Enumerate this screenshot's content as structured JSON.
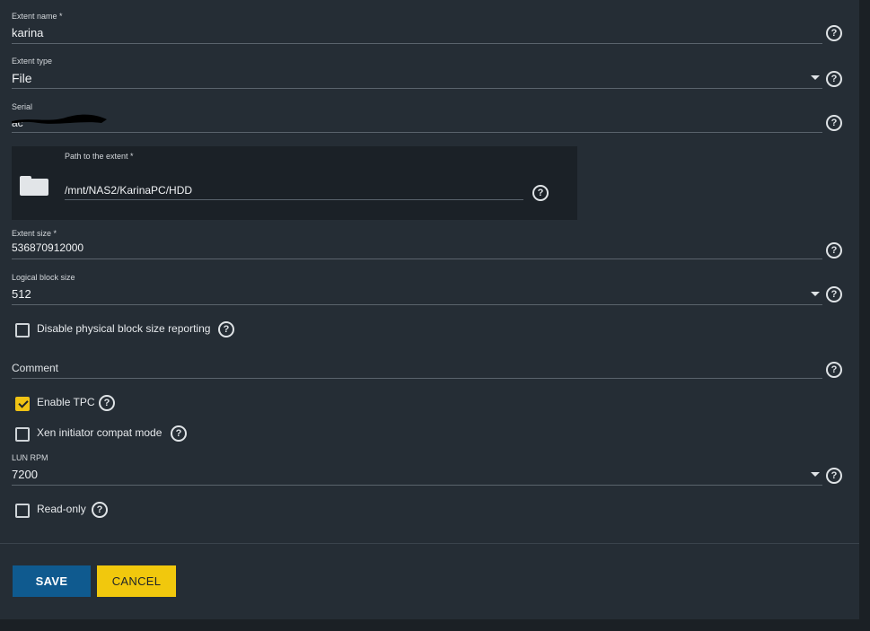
{
  "form": {
    "extent_name": {
      "label": "Extent name *",
      "value": "karina"
    },
    "extent_type": {
      "label": "Extent type",
      "value": "File"
    },
    "serial": {
      "label": "Serial",
      "value": "ac"
    },
    "path": {
      "label": "Path to the extent *",
      "value": "/mnt/NAS2/KarinaPC/HDD"
    },
    "extent_size": {
      "label": "Extent size *",
      "value": "536870912000"
    },
    "logical_block_size": {
      "label": "Logical block size",
      "value": "512"
    },
    "disable_physical_block": {
      "label": "Disable physical block size reporting",
      "checked": false
    },
    "comment": {
      "label": "Comment",
      "value": ""
    },
    "enable_tpc": {
      "label": "Enable TPC",
      "checked": true
    },
    "xen_compat": {
      "label": "Xen initiator compat mode",
      "checked": false
    },
    "lun_rpm": {
      "label": "LUN RPM",
      "value": "7200"
    },
    "read_only": {
      "label": "Read-only",
      "checked": false
    }
  },
  "help_glyph": "?",
  "actions": {
    "save_label": "SAVE",
    "cancel_label": "CANCEL"
  },
  "icons": {
    "help": "help-circle-icon",
    "folder": "folder-icon",
    "dropdown": "chevron-down-icon"
  },
  "colors": {
    "background": "#252d35",
    "primary": "#0f5a8f",
    "accent": "#f1c80d"
  }
}
